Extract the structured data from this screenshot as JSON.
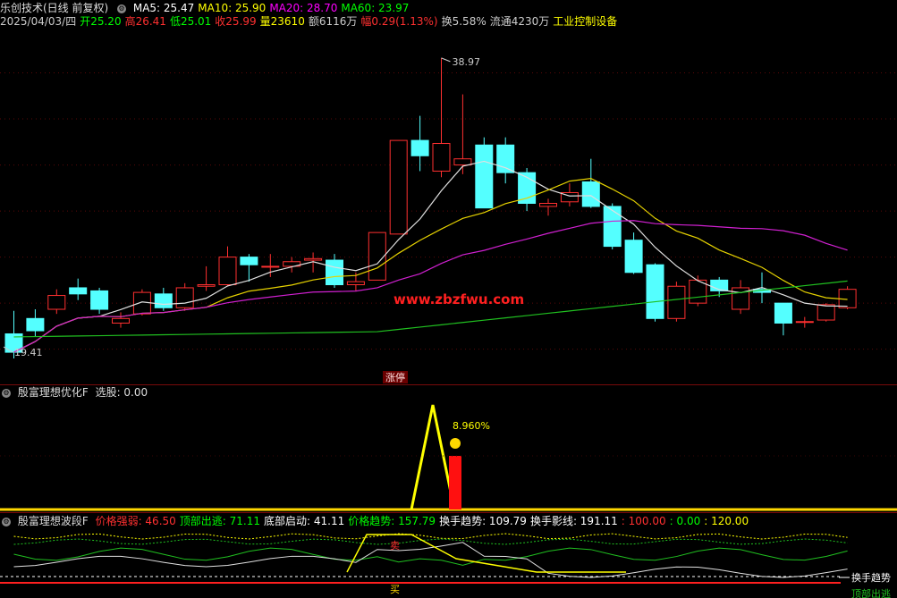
{
  "header": {
    "title": "乐创技术(日线 前复权)",
    "ma": [
      {
        "label": "MA5: 25.47",
        "color": "#ffffff"
      },
      {
        "label": "MA10: 25.90",
        "color": "#ffff00"
      },
      {
        "label": "MA20: 28.70",
        "color": "#ff00ff"
      },
      {
        "label": "MA60: 23.97",
        "color": "#00ff00"
      }
    ],
    "quote": [
      {
        "label": "2025/04/03/四",
        "color": "#cccccc"
      },
      {
        "label": "开25.20",
        "color": "#00ff00"
      },
      {
        "label": "高26.41",
        "color": "#ff3030"
      },
      {
        "label": "低25.01",
        "color": "#00ff00"
      },
      {
        "label": "收25.99",
        "color": "#ff3030"
      },
      {
        "label": "量23610",
        "color": "#ffff00"
      },
      {
        "label": "额6116万",
        "color": "#cccccc"
      },
      {
        "label": "幅0.29(1.13%)",
        "color": "#ff3030"
      },
      {
        "label": "换5.58%",
        "color": "#cccccc"
      },
      {
        "label": "流通4230万",
        "color": "#cccccc"
      },
      {
        "label": "工业控制设备",
        "color": "#ffff00"
      }
    ]
  },
  "watermark": "www.zbzfwu.com",
  "annotations": {
    "high_label": "38.97",
    "low_label": "19.41",
    "tag": "涨停"
  },
  "panel2": {
    "title": "殷富理想优化F",
    "metric": "选股: 0.00",
    "signal_pct": "8.960%"
  },
  "panel3": {
    "title": "殷富理想波段F",
    "metrics": [
      {
        "label": "价格强弱: 46.50",
        "color": "#ff3030"
      },
      {
        "label": "顶部出逃: 71.11",
        "color": "#00ff00"
      },
      {
        "label": "底部启动: 41.11",
        "color": "#ffffff"
      },
      {
        "label": "价格趋势: 157.79",
        "color": "#00ff00"
      },
      {
        "label": "换手趋势: 109.79",
        "color": "#ffffff"
      },
      {
        "label": "换手影线: 191.11",
        "color": "#ffffff"
      },
      {
        "label": ": 100.00",
        "color": "#ff3030"
      },
      {
        "label": ": 0.00",
        "color": "#00ff00"
      },
      {
        "label": ": 120.00",
        "color": "#ffff00"
      }
    ],
    "legend_turnover": "换手趋势",
    "legend_top": "顶部出逃",
    "sell_label": "卖",
    "buy_label": "买"
  },
  "colors": {
    "up": "#ff3030",
    "down": "#54ffff",
    "ma5": "#e0e0e0",
    "ma10": "#e6d200",
    "ma20": "#d020d0",
    "ma60": "#20c020"
  },
  "chart_data": {
    "type": "candlestick",
    "price_range": [
      18.0,
      41.0
    ],
    "candles": [
      [
        21.0,
        19.8,
        22.5,
        19.4
      ],
      [
        22.0,
        21.2,
        22.6,
        20.8
      ],
      [
        22.6,
        23.5,
        23.9,
        22.3
      ],
      [
        24.0,
        23.6,
        24.6,
        23.2
      ],
      [
        23.8,
        22.6,
        24.0,
        22.3
      ],
      [
        21.7,
        22.0,
        22.4,
        21.4
      ],
      [
        22.3,
        23.7,
        23.9,
        22.2
      ],
      [
        23.6,
        22.7,
        24.0,
        22.5
      ],
      [
        22.7,
        24.0,
        24.3,
        22.5
      ],
      [
        24.1,
        24.2,
        25.4,
        23.8
      ],
      [
        24.2,
        26.0,
        26.7,
        24.1
      ],
      [
        26.0,
        25.5,
        26.2,
        24.4
      ],
      [
        25.4,
        25.4,
        26.2,
        24.7
      ],
      [
        25.4,
        25.7,
        26.0,
        25.0
      ],
      [
        25.8,
        25.9,
        26.3,
        25.0
      ],
      [
        25.8,
        24.2,
        26.2,
        24.0
      ],
      [
        24.2,
        24.4,
        25.0,
        23.8
      ],
      [
        24.5,
        27.6,
        27.6,
        24.5
      ],
      [
        27.5,
        33.6,
        33.6,
        27.5
      ],
      [
        33.6,
        32.6,
        35.2,
        31.6
      ],
      [
        31.6,
        33.4,
        38.97,
        31.2
      ],
      [
        32.0,
        32.4,
        36.6,
        31.4
      ],
      [
        33.3,
        29.2,
        33.8,
        29.2
      ],
      [
        33.3,
        31.5,
        33.8,
        30.8
      ],
      [
        31.5,
        29.5,
        31.8,
        29.0
      ],
      [
        29.3,
        29.5,
        29.8,
        28.7
      ],
      [
        29.6,
        30.2,
        30.8,
        29.3
      ],
      [
        30.9,
        29.3,
        32.4,
        29.2
      ],
      [
        29.3,
        26.7,
        29.5,
        26.5
      ],
      [
        27.1,
        25.0,
        27.6,
        24.9
      ],
      [
        25.5,
        22.0,
        25.6,
        21.8
      ],
      [
        22.0,
        24.1,
        24.4,
        21.8
      ],
      [
        23.0,
        24.5,
        24.8,
        22.8
      ],
      [
        24.5,
        23.8,
        24.7,
        23.4
      ],
      [
        22.6,
        24.0,
        24.5,
        22.3
      ],
      [
        23.9,
        23.7,
        25.0,
        23.0
      ],
      [
        23.0,
        21.7,
        23.0,
        20.9
      ],
      [
        21.8,
        21.8,
        22.1,
        21.4
      ],
      [
        21.9,
        22.9,
        23.0,
        21.8
      ],
      [
        22.7,
        23.9,
        24.1,
        22.6
      ]
    ]
  }
}
